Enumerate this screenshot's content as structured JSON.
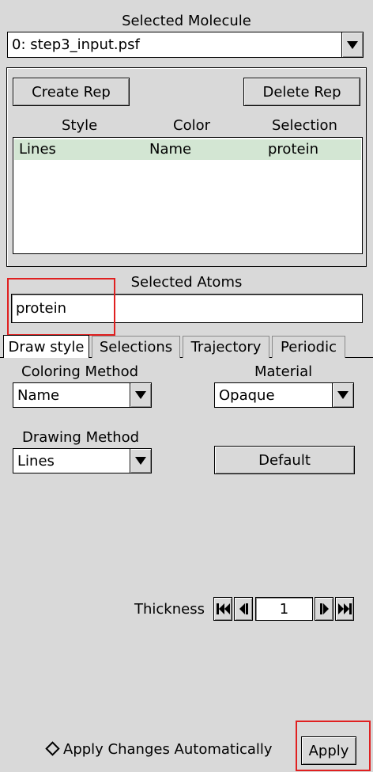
{
  "molecule": {
    "label": "Selected Molecule",
    "value": "0: step3_input.psf"
  },
  "reps": {
    "create_label": "Create Rep",
    "delete_label": "Delete Rep",
    "columns": [
      "Style",
      "Color",
      "Selection"
    ],
    "rows": [
      {
        "style": "Lines",
        "color": "Name",
        "selection": "protein"
      }
    ]
  },
  "atoms": {
    "label": "Selected Atoms",
    "value": "protein"
  },
  "tabs": [
    "Draw style",
    "Selections",
    "Trajectory",
    "Periodic"
  ],
  "draw": {
    "coloring_label": "Coloring Method",
    "coloring_value": "Name",
    "material_label": "Material",
    "material_value": "Opaque",
    "drawing_label": "Drawing Method",
    "drawing_value": "Lines",
    "default_label": "Default",
    "thickness_label": "Thickness",
    "thickness_value": "1"
  },
  "footer": {
    "auto_label": "Apply Changes Automatically",
    "apply_label": "Apply"
  },
  "colors": {
    "background": "#d9d9d9",
    "row_selected": "#d3e6d3",
    "highlight": "#e02020"
  }
}
